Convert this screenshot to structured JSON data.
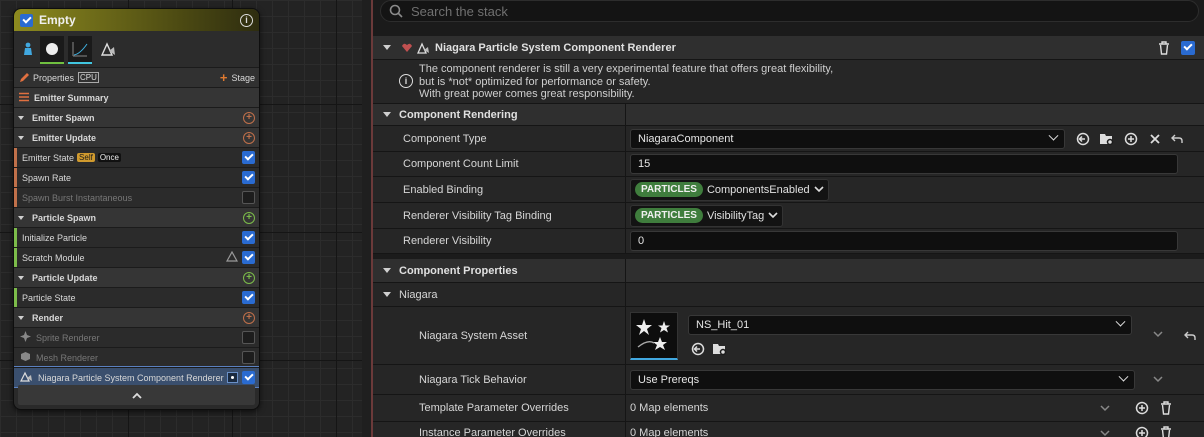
{
  "node": {
    "title": "Empty",
    "properties_label": "Properties",
    "cpu_label": "CPU",
    "stage_label": "Stage",
    "rows": [
      {
        "label": "Emitter Summary",
        "kind": "summary"
      },
      {
        "label": "Emitter Spawn",
        "kind": "hdr",
        "bar": "#c0704a",
        "plus": "r"
      },
      {
        "label": "Emitter Update",
        "kind": "hdr",
        "bar": "#c0704a",
        "plus": "r"
      },
      {
        "label": "Emitter State",
        "kind": "item",
        "bar": "#c0704a",
        "tags": [
          "Self",
          "Once"
        ],
        "checked": true
      },
      {
        "label": "Spawn Rate",
        "kind": "item",
        "bar": "#c0704a",
        "checked": true
      },
      {
        "label": "Spawn Burst Instantaneous",
        "kind": "item",
        "bar": "#c0704a",
        "dim": true,
        "checked": false
      },
      {
        "label": "Particle Spawn",
        "kind": "hdr",
        "bar": "#7cbc4a",
        "plus": "g"
      },
      {
        "label": "Initialize Particle",
        "kind": "item",
        "bar": "#7cbc4a",
        "checked": true
      },
      {
        "label": "Scratch Module",
        "kind": "item",
        "bar": "#7cbc4a",
        "checked": true
      },
      {
        "label": "Particle Update",
        "kind": "hdr",
        "bar": "#7cbc4a",
        "plus": "g"
      },
      {
        "label": "Particle State",
        "kind": "item",
        "bar": "#7cbc4a",
        "checked": true
      },
      {
        "label": "Render",
        "kind": "hdr",
        "bar": "#c0704a",
        "plus": "r"
      },
      {
        "label": "Sprite Renderer",
        "kind": "render",
        "dim": true,
        "checked": false
      },
      {
        "label": "Mesh Renderer",
        "kind": "render",
        "dim": true,
        "checked": false
      },
      {
        "label": "Niagara Particle System Component Renderer",
        "kind": "render",
        "selected": true,
        "checked": true
      }
    ]
  },
  "search": {
    "placeholder": "Search the stack"
  },
  "renderer": {
    "title": "Niagara Particle System Component Renderer",
    "info_lines": [
      "The component renderer is still a very experimental feature that offers great flexibility,",
      "but is *not* optimized for performance or safety.",
      "With great power comes great responsibility."
    ]
  },
  "component_rendering": {
    "section": "Component Rendering",
    "component_type": {
      "label": "Component Type",
      "value": "NiagaraComponent"
    },
    "component_count_limit": {
      "label": "Component Count Limit",
      "value": "15"
    },
    "enabled_binding": {
      "label": "Enabled Binding",
      "badge": "PARTICLES",
      "value": "ComponentsEnabled"
    },
    "visibility_tag_binding": {
      "label": "Renderer Visibility Tag Binding",
      "badge": "PARTICLES",
      "value": "VisibilityTag"
    },
    "renderer_visibility": {
      "label": "Renderer Visibility",
      "value": "0"
    }
  },
  "component_properties": {
    "section": "Component Properties",
    "niagara": "Niagara",
    "system_asset": {
      "label": "Niagara System Asset",
      "value": "NS_Hit_01"
    },
    "tick_behavior": {
      "label": "Niagara Tick Behavior",
      "value": "Use Prereqs"
    },
    "template_overrides": {
      "label": "Template Parameter Overrides",
      "value": "0 Map elements"
    },
    "instance_overrides": {
      "label": "Instance Parameter Overrides",
      "value": "0 Map elements"
    }
  },
  "colors": {
    "accent": "#2a6bd1",
    "particles_badge": "#3f7d3d",
    "spawn": "#c0704a",
    "particle": "#7cbc4a"
  }
}
